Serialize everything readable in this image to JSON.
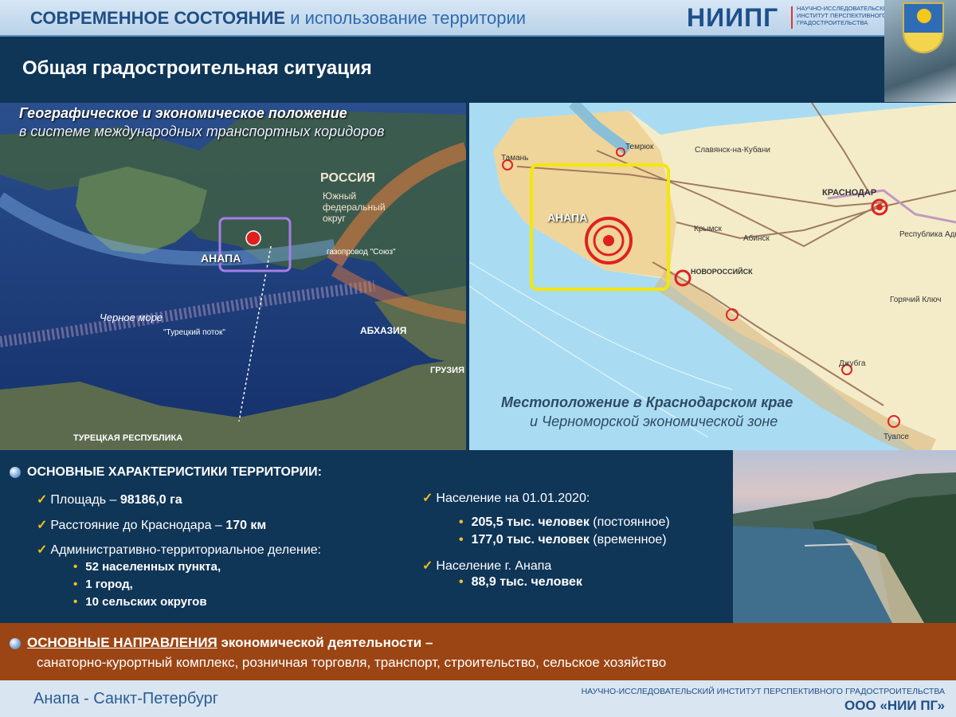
{
  "header": {
    "title_bold": "СОВРЕМЕННОЕ СОСТОЯНИЕ",
    "title_rest": "и использование территории",
    "brand": "НИИПГ",
    "brand_sub": "НАУЧНО-ИССЛЕДОВАТЕЛЬСКИЙ ИНСТИТУТ ПЕРСПЕКТИВНОГО ГРАДОСТРОИТЕЛЬСТВА"
  },
  "subtitle": "Общая градостроительная ситуация",
  "map_left": {
    "title": "Географическое и экономическое положение",
    "subtitle": "в системе международных транспортных коридоров",
    "labels": {
      "russia": "РОССИЯ",
      "south_district": "Южный федеральный округ",
      "black_sea": "Черное море",
      "turkish_stream": "\"Турецкий поток\"",
      "abkhazia": "АБХАЗИЯ",
      "georgia": "ГРУЗИЯ",
      "turkey": "ТУРЕЦКАЯ РЕСПУБЛИКА",
      "pipeline": "газопровод \"Союз\"",
      "anapa": "АНАПА"
    }
  },
  "map_right": {
    "caption_bold": "Местоположение в Краснодарском крае",
    "caption_rest": "и Черноморской экономической зоне",
    "labels": {
      "anapa": "АНАПА",
      "krasnodar": "КРАСНОДАР",
      "novorossiysk": "НОВОРОССИЙСК",
      "temryuk": "Темрюк",
      "taman": "Тамань",
      "slavyansk": "Славянск-на-Кубани",
      "krymsk": "Крымск",
      "abinsk": "Абинск",
      "dzhubga": "Джубга",
      "tuapse": "Туапсе",
      "goryachy": "Горячий Ключ",
      "adygea": "Республика Адыгея"
    }
  },
  "characteristics": {
    "heading": "ОСНОВНЫЕ ХАРАКТЕРИСТИКИ ТЕРРИТОРИИ:",
    "area_label": "Площадь – ",
    "area_value": "98186,0 га",
    "distance_label": "Расстояние до Краснодара – ",
    "distance_value": "170 км",
    "admin_label": "Административно-территориальное деление:",
    "admin_items": [
      "52 населенных пункта,",
      "1 город,",
      "10 сельских округов"
    ],
    "population_label": "Население на 01.01.2020:",
    "pop_permanent_value": "205,5 тыс. человек",
    "pop_permanent_note": " (постоянное)",
    "pop_temporary_value": "177,0 тыс. человек",
    "pop_temporary_note": " (временное)",
    "city_pop_label": "Население г. Анапа",
    "city_pop_value": "88,9 тыс. человек"
  },
  "economy": {
    "bold_1": "ОСНОВНЫЕ НАПРАВЛЕНИЯ",
    "bold_2": " экономической деятельности –",
    "line_2": "санаторно-курортный комплекс, розничная торговля, транспорт, строительство, сельское хозяйство"
  },
  "footer": {
    "left": "Анапа - Санкт-Петербург",
    "right_top": "НАУЧНО-ИССЛЕДОВАТЕЛЬСКИЙ ИНСТИТУТ ПЕРСПЕКТИВНОГО ГРАДОСТРОИТЕЛЬСТВА",
    "right_bottom": "ООО «НИИ ПГ»"
  }
}
